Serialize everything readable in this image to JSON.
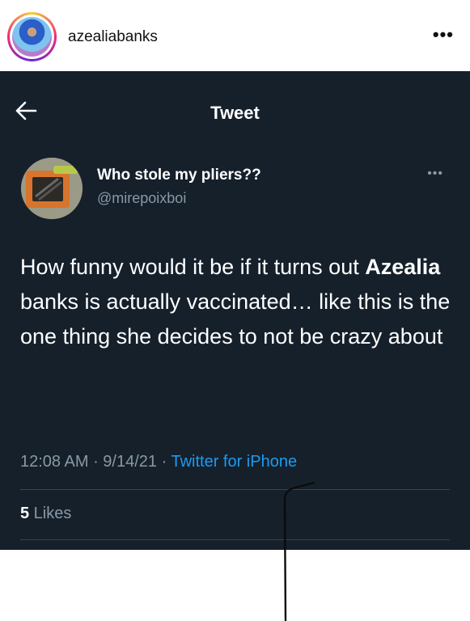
{
  "instagram": {
    "username": "azealiabanks",
    "more_icon": "more-horizontal-icon"
  },
  "tweet_view": {
    "header_title": "Tweet",
    "back_icon": "arrow-left-icon"
  },
  "tweet": {
    "author_name": "Who stole my pliers??",
    "author_handle": "@mirepoixboi",
    "text_part1": "How funny would it be if it turns out ",
    "text_bold": "Azealia",
    "text_part2": " banks is actually vaccinated… like this is the one thing she decides to not be crazy about",
    "time": "12:08 AM",
    "date": "9/14/21",
    "separator": " · ",
    "source": "Twitter for iPhone",
    "likes_count": "5",
    "likes_label": " Likes"
  },
  "colors": {
    "tweet_background": "#15202b",
    "secondary_text": "#8899a6",
    "link_blue": "#1d9bf0",
    "divider": "#38444d"
  }
}
